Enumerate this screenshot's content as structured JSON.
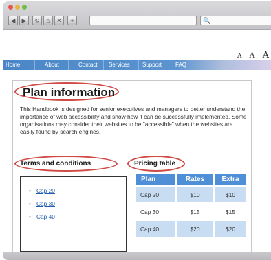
{
  "browser": {
    "traffic_lights": {
      "close_color": "#e9564f",
      "minimize_color": "#e7b53c",
      "zoom_color": "#6fbf4a"
    },
    "buttons": [
      {
        "icon": "back-icon",
        "glyph": "◀"
      },
      {
        "icon": "forward-icon",
        "glyph": "▶"
      },
      {
        "icon": "reload-icon",
        "glyph": "↻"
      },
      {
        "icon": "home-icon",
        "glyph": "⌂"
      },
      {
        "icon": "stop-icon",
        "glyph": "✕"
      },
      {
        "icon": "add-icon",
        "glyph": "+"
      }
    ],
    "url_value": "",
    "search_icon": "🔍"
  },
  "page": {
    "text_size": [
      "A",
      "A",
      "A"
    ],
    "nav": [
      "Home",
      "About",
      "Contact",
      "Services",
      "Support",
      "FAQ"
    ],
    "title": "Plan information",
    "intro": "This Handbook is designed for senior executives and managers to better understand the importance of web accessibility and show how it can be successfully implemented. Some organisations may consider their websites to be \"accessible\" when the websites are easily found by search engines.",
    "terms": {
      "heading": "Terms and conditions",
      "links": [
        "Cap 20",
        "Cap 30",
        "Cap 40"
      ]
    },
    "pricing": {
      "heading": "Pricing table",
      "headers": [
        "Plan",
        "Rates",
        "Extra"
      ],
      "rows": [
        [
          "Cap 20",
          "$10",
          "$10"
        ],
        [
          "Cap 30",
          "$15",
          "$15"
        ],
        [
          "Cap 40",
          "$20",
          "$20"
        ]
      ]
    }
  },
  "colors": {
    "nav_blue": "#4a86c7",
    "accent_red_outline": "#cf4a44",
    "table_header": "#4f8fd8",
    "table_row_alt": "#c8dcf2",
    "link": "#1f5bb0"
  }
}
